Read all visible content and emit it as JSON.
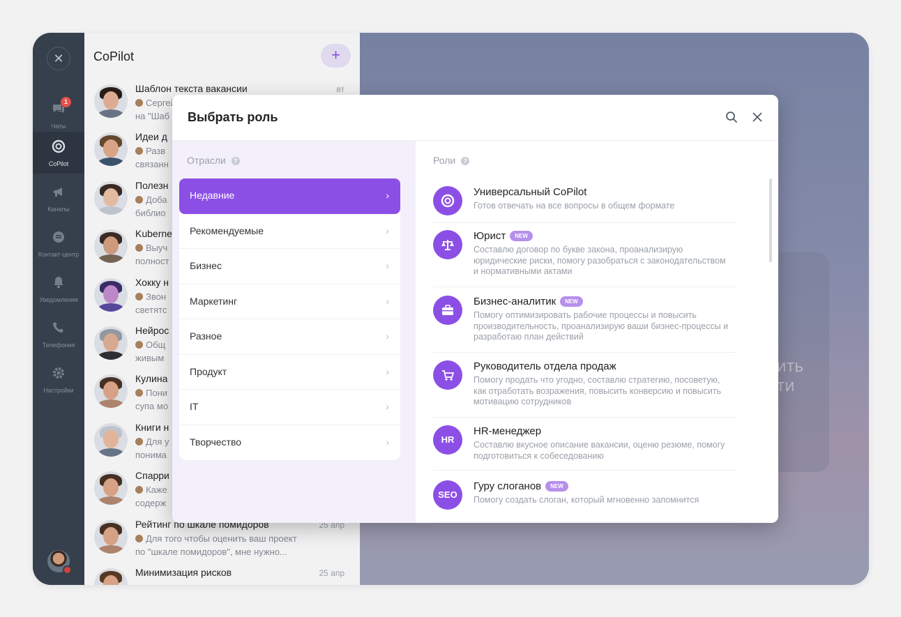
{
  "rail": {
    "items": [
      {
        "label": "Чаты",
        "icon": "chat-icon",
        "badge": "1"
      },
      {
        "label": "CoPilot",
        "icon": "copilot-icon"
      },
      {
        "label": "Каналы",
        "icon": "megaphone-icon"
      },
      {
        "label": "Контакт-центр",
        "icon": "contact-center-icon"
      },
      {
        "label": "Уведомления",
        "icon": "bell-icon"
      },
      {
        "label": "Телефония",
        "icon": "phone-icon"
      },
      {
        "label": "Настройки",
        "icon": "gear-icon"
      }
    ]
  },
  "chatlist": {
    "title": "CoPilot",
    "add_label": "+",
    "chats": [
      {
        "name": "Шаблон текста вакансии",
        "prev1": "Сергей",
        "prev2": "на \"Шаб",
        "date": "вт"
      },
      {
        "name": "Идеи д",
        "prev1": "Разв",
        "prev2": "связанн",
        "date": ""
      },
      {
        "name": "Полезн",
        "prev1": "Доба",
        "prev2": "библио",
        "date": ""
      },
      {
        "name": "Kuberne",
        "prev1": "Выуч",
        "prev2": "полност",
        "date": ""
      },
      {
        "name": "Хокку н",
        "prev1": "Звон",
        "prev2": "светятс",
        "date": ""
      },
      {
        "name": "Нейрос",
        "prev1": "Общ",
        "prev2": "живым",
        "date": ""
      },
      {
        "name": "Кулина",
        "prev1": "Пони",
        "prev2": "супа мо",
        "date": ""
      },
      {
        "name": "Книги н",
        "prev1": "Для у",
        "prev2": "понима",
        "date": ""
      },
      {
        "name": "Спарри",
        "prev1": "Каже",
        "prev2": "содерж",
        "date": ""
      },
      {
        "name": "Рейтинг по шкале помидоров",
        "prev1": "Для того чтобы оценить ваш проект",
        "prev2": "по \"шкале помидоров\", мне нужно...",
        "date": "25 апр"
      },
      {
        "name": "Минимизация рисков",
        "prev1": "",
        "prev2": "",
        "date": "25 апр"
      }
    ]
  },
  "wallpaper": {
    "line1": "ИТЬ",
    "line2": "ТИ"
  },
  "modal": {
    "title": "Выбрать роль",
    "industries_label": "Отрасли",
    "roles_label": "Роли",
    "help_glyph": "?",
    "industries": [
      "Недавние",
      "Рекомендуемые",
      "Бизнес",
      "Маркетинг",
      "Разное",
      "Продукт",
      "IT",
      "Творчество"
    ],
    "selected_industry": "Недавние",
    "chevron": "›",
    "new_badge": "NEW",
    "roles": [
      {
        "name": "Универсальный CoPilot",
        "desc": "Готов отвечать на все вопросы в общем формате",
        "icon": "copilot-icon",
        "new": false
      },
      {
        "name": "Юрист",
        "desc": "Составлю договор по букве закона, проанализирую юридические риски, помогу разобраться с законодательством и нормативными актами",
        "icon": "scales-icon",
        "new": true
      },
      {
        "name": "Бизнес-аналитик",
        "desc": "Помогу оптимизировать рабочие процессы и повысить производительность, проанализирую ваши бизнес-процессы и разработаю план действий",
        "icon": "briefcase-icon",
        "new": true
      },
      {
        "name": "Руководитель отдела продаж",
        "desc": "Помогу продать что угодно, составлю стратегию, посоветую, как отработать возражения, повысить конверсию и повысить мотивацию сотрудников",
        "icon": "cart-icon",
        "new": false
      },
      {
        "name": "HR-менеджер",
        "desc": "Составлю вкусное описание вакансии, оценю резюме, помогу подготовиться к собеседованию",
        "icon_text": "HR",
        "new": false
      },
      {
        "name": "Гуру слоганов",
        "desc": "Помогу создать слоган, который мгновенно запомнится",
        "icon_text": "SEO",
        "new": true
      }
    ]
  },
  "colors": {
    "accent": "#8c4fe6",
    "rail": "#38424e",
    "industries_bg": "#f3f0fc"
  }
}
